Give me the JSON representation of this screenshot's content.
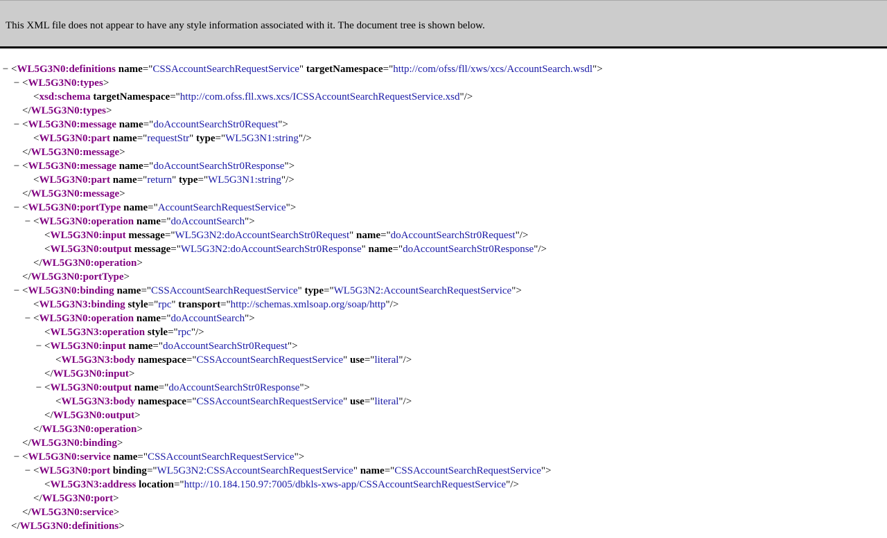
{
  "header": {
    "text": "This XML file does not appear to have any style information associated with it. The document tree is shown below."
  },
  "toggle_symbol": "−",
  "lines": [
    {
      "depth": 0,
      "toggle": true,
      "kind": "open",
      "tag": "WL5G3N0:definitions",
      "attrs": [
        {
          "n": "name",
          "v": "CSSAccountSearchRequestService"
        },
        {
          "n": "targetNamespace",
          "v": "http://com/ofss/fll/xws/xcs/AccountSearch.wsdl"
        }
      ]
    },
    {
      "depth": 1,
      "toggle": true,
      "kind": "open",
      "tag": "WL5G3N0:types",
      "attrs": []
    },
    {
      "depth": 2,
      "toggle": false,
      "kind": "self",
      "tag": "xsd:schema",
      "attrs": [
        {
          "n": "targetNamespace",
          "v": "http://com.ofss.fll.xws.xcs/ICSSAccountSearchRequestService.xsd"
        }
      ]
    },
    {
      "depth": 1,
      "toggle": false,
      "kind": "close",
      "tag": "WL5G3N0:types",
      "attrs": []
    },
    {
      "depth": 1,
      "toggle": true,
      "kind": "open",
      "tag": "WL5G3N0:message",
      "attrs": [
        {
          "n": "name",
          "v": "doAccountSearchStr0Request"
        }
      ]
    },
    {
      "depth": 2,
      "toggle": false,
      "kind": "self",
      "tag": "WL5G3N0:part",
      "attrs": [
        {
          "n": "name",
          "v": "requestStr"
        },
        {
          "n": "type",
          "v": "WL5G3N1:string"
        }
      ]
    },
    {
      "depth": 1,
      "toggle": false,
      "kind": "close",
      "tag": "WL5G3N0:message",
      "attrs": []
    },
    {
      "depth": 1,
      "toggle": true,
      "kind": "open",
      "tag": "WL5G3N0:message",
      "attrs": [
        {
          "n": "name",
          "v": "doAccountSearchStr0Response"
        }
      ]
    },
    {
      "depth": 2,
      "toggle": false,
      "kind": "self",
      "tag": "WL5G3N0:part",
      "attrs": [
        {
          "n": "name",
          "v": "return"
        },
        {
          "n": "type",
          "v": "WL5G3N1:string"
        }
      ]
    },
    {
      "depth": 1,
      "toggle": false,
      "kind": "close",
      "tag": "WL5G3N0:message",
      "attrs": []
    },
    {
      "depth": 1,
      "toggle": true,
      "kind": "open",
      "tag": "WL5G3N0:portType",
      "attrs": [
        {
          "n": "name",
          "v": "AccountSearchRequestService"
        }
      ]
    },
    {
      "depth": 2,
      "toggle": true,
      "kind": "open",
      "tag": "WL5G3N0:operation",
      "attrs": [
        {
          "n": "name",
          "v": "doAccountSearch"
        }
      ]
    },
    {
      "depth": 3,
      "toggle": false,
      "kind": "self",
      "tag": "WL5G3N0:input",
      "attrs": [
        {
          "n": "message",
          "v": "WL5G3N2:doAccountSearchStr0Request"
        },
        {
          "n": "name",
          "v": "doAccountSearchStr0Request"
        }
      ]
    },
    {
      "depth": 3,
      "toggle": false,
      "kind": "self",
      "tag": "WL5G3N0:output",
      "attrs": [
        {
          "n": "message",
          "v": "WL5G3N2:doAccountSearchStr0Response"
        },
        {
          "n": "name",
          "v": "doAccountSearchStr0Response"
        }
      ]
    },
    {
      "depth": 2,
      "toggle": false,
      "kind": "close",
      "tag": "WL5G3N0:operation",
      "attrs": []
    },
    {
      "depth": 1,
      "toggle": false,
      "kind": "close",
      "tag": "WL5G3N0:portType",
      "attrs": []
    },
    {
      "depth": 1,
      "toggle": true,
      "kind": "open",
      "tag": "WL5G3N0:binding",
      "attrs": [
        {
          "n": "name",
          "v": "CSSAccountSearchRequestService"
        },
        {
          "n": "type",
          "v": "WL5G3N2:AccountSearchRequestService"
        }
      ]
    },
    {
      "depth": 2,
      "toggle": false,
      "kind": "self",
      "tag": "WL5G3N3:binding",
      "attrs": [
        {
          "n": "style",
          "v": "rpc"
        },
        {
          "n": "transport",
          "v": "http://schemas.xmlsoap.org/soap/http"
        }
      ]
    },
    {
      "depth": 2,
      "toggle": true,
      "kind": "open",
      "tag": "WL5G3N0:operation",
      "attrs": [
        {
          "n": "name",
          "v": "doAccountSearch"
        }
      ]
    },
    {
      "depth": 3,
      "toggle": false,
      "kind": "self",
      "tag": "WL5G3N3:operation",
      "attrs": [
        {
          "n": "style",
          "v": "rpc"
        }
      ]
    },
    {
      "depth": 3,
      "toggle": true,
      "kind": "open",
      "tag": "WL5G3N0:input",
      "attrs": [
        {
          "n": "name",
          "v": "doAccountSearchStr0Request"
        }
      ]
    },
    {
      "depth": 4,
      "toggle": false,
      "kind": "self",
      "tag": "WL5G3N3:body",
      "attrs": [
        {
          "n": "namespace",
          "v": "CSSAccountSearchRequestService"
        },
        {
          "n": "use",
          "v": "literal"
        }
      ]
    },
    {
      "depth": 3,
      "toggle": false,
      "kind": "close",
      "tag": "WL5G3N0:input",
      "attrs": []
    },
    {
      "depth": 3,
      "toggle": true,
      "kind": "open",
      "tag": "WL5G3N0:output",
      "attrs": [
        {
          "n": "name",
          "v": "doAccountSearchStr0Response"
        }
      ]
    },
    {
      "depth": 4,
      "toggle": false,
      "kind": "self",
      "tag": "WL5G3N3:body",
      "attrs": [
        {
          "n": "namespace",
          "v": "CSSAccountSearchRequestService"
        },
        {
          "n": "use",
          "v": "literal"
        }
      ]
    },
    {
      "depth": 3,
      "toggle": false,
      "kind": "close",
      "tag": "WL5G3N0:output",
      "attrs": []
    },
    {
      "depth": 2,
      "toggle": false,
      "kind": "close",
      "tag": "WL5G3N0:operation",
      "attrs": []
    },
    {
      "depth": 1,
      "toggle": false,
      "kind": "close",
      "tag": "WL5G3N0:binding",
      "attrs": []
    },
    {
      "depth": 1,
      "toggle": true,
      "kind": "open",
      "tag": "WL5G3N0:service",
      "attrs": [
        {
          "n": "name",
          "v": "CSSAccountSearchRequestService"
        }
      ]
    },
    {
      "depth": 2,
      "toggle": true,
      "kind": "open",
      "tag": "WL5G3N0:port",
      "attrs": [
        {
          "n": "binding",
          "v": "WL5G3N2:CSSAccountSearchRequestService"
        },
        {
          "n": "name",
          "v": "CSSAccountSearchRequestService"
        }
      ]
    },
    {
      "depth": 3,
      "toggle": false,
      "kind": "self",
      "tag": "WL5G3N3:address",
      "attrs": [
        {
          "n": "location",
          "v": "http://10.184.150.97:7005/dbkls-xws-app/CSSAccountSearchRequestService"
        }
      ]
    },
    {
      "depth": 2,
      "toggle": false,
      "kind": "close",
      "tag": "WL5G3N0:port",
      "attrs": []
    },
    {
      "depth": 1,
      "toggle": false,
      "kind": "close",
      "tag": "WL5G3N0:service",
      "attrs": []
    },
    {
      "depth": 0,
      "toggle": false,
      "kind": "close",
      "tag": "WL5G3N0:definitions",
      "attrs": []
    }
  ]
}
